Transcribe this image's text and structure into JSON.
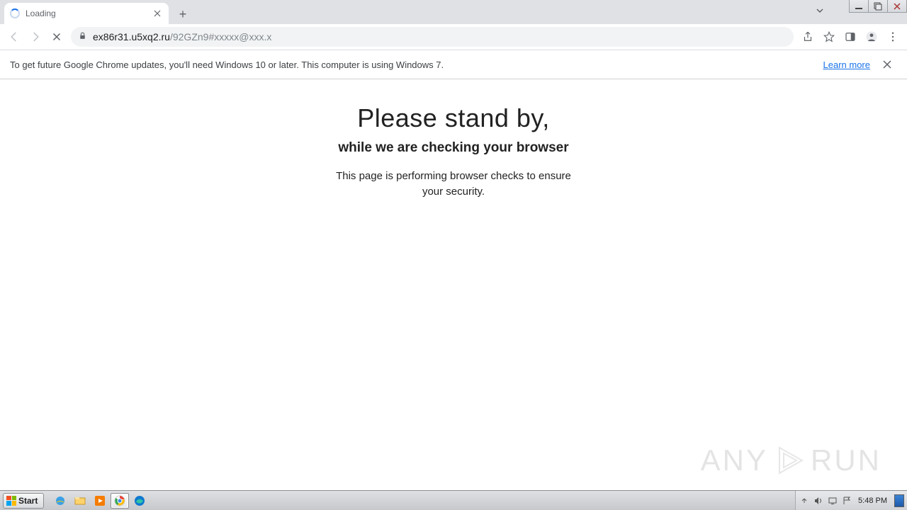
{
  "window_controls": {
    "minimize": "min",
    "maximize": "max",
    "close": "x"
  },
  "tab": {
    "title": "Loading"
  },
  "url": {
    "host": "ex86r31.u5xq2.ru",
    "path": "/92GZn9#xxxxx@xxx.x"
  },
  "infobar": {
    "message": "To get future Google Chrome updates, you'll need Windows 10 or later. This computer is using Windows 7.",
    "learn_more": "Learn more"
  },
  "page": {
    "heading": "Please stand by,",
    "subheading": "while we are checking your browser",
    "body": "This page is performing browser checks to ensure your security."
  },
  "watermark": {
    "left": "ANY",
    "right": "RUN"
  },
  "taskbar": {
    "start": "Start",
    "clock": "5:48 PM"
  }
}
